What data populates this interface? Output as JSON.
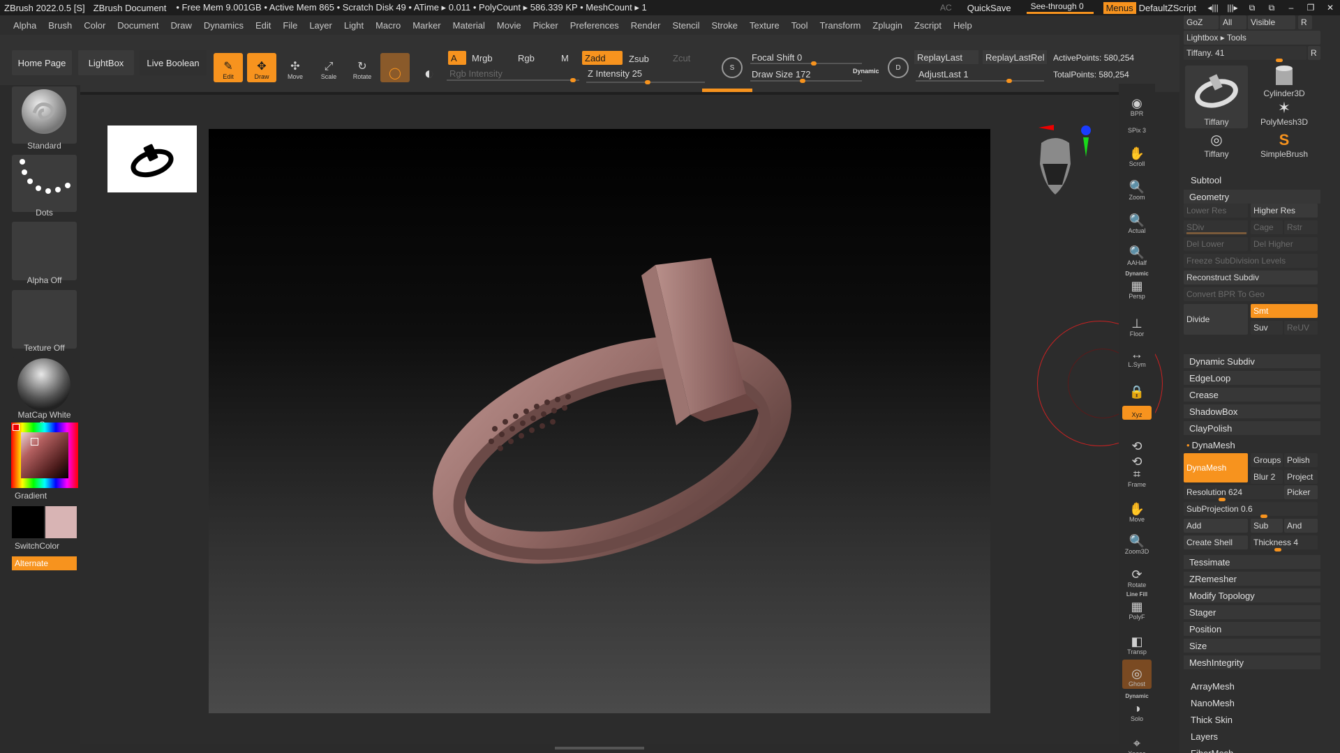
{
  "titlebar": {
    "app": "ZBrush 2022.0.5 [S]",
    "document": "ZBrush Document",
    "stats": "• Free Mem 9.001GB • Active Mem 865 • Scratch Disk 49 •   ATime ▸ 0.011 • PolyCount ▸ 586.339 KP  • MeshCount ▸ 1",
    "ac": "AC",
    "quicksave": "QuickSave",
    "see_through": "See-through  0",
    "menus": "Menus",
    "default_zscript": "DefaultZScript"
  },
  "menubar": [
    "Alpha",
    "Brush",
    "Color",
    "Document",
    "Draw",
    "Dynamics",
    "Edit",
    "File",
    "Layer",
    "Light",
    "Macro",
    "Marker",
    "Material",
    "Movie",
    "Picker",
    "Preferences",
    "Render",
    "Stencil",
    "Stroke",
    "Texture",
    "Tool",
    "Transform",
    "Zplugin",
    "Zscript",
    "Help"
  ],
  "shelf": {
    "home_page": "Home Page",
    "lightbox": "LightBox",
    "live_boolean": "Live Boolean",
    "tools": [
      {
        "label": "Edit",
        "active": true
      },
      {
        "label": "Draw",
        "active": true
      },
      {
        "label": "Move",
        "active": false
      },
      {
        "label": "Scale",
        "active": false
      },
      {
        "label": "Rotate",
        "active": false
      }
    ],
    "a": "A",
    "mrgb": "Mrgb",
    "rgb": "Rgb",
    "m": "M",
    "zadd": "Zadd",
    "zsub": "Zsub",
    "zcut": "Zcut",
    "rgb_intensity": "Rgb Intensity",
    "z_intensity": "Z Intensity 25",
    "focal_shift": "Focal Shift 0",
    "draw_size": "Draw Size 172",
    "dynamic": "Dynamic",
    "replay_last": "ReplayLast",
    "replay_last_rel": "ReplayLastRel",
    "adjust_last": "AdjustLast 1",
    "active_points": "ActivePoints: 580,254",
    "total_points": "TotalPoints: 580,254",
    "s_label": "S",
    "d_label": "D"
  },
  "left": {
    "brush": "Standard",
    "stroke": "Dots",
    "alpha": "Alpha Off",
    "texture": "Texture Off",
    "material": "MatCap White Ca",
    "gradient": "Gradient",
    "switch_color": "SwitchColor",
    "alternate": "Alternate",
    "colors": {
      "main": "#000000",
      "secondary": "#d8b4b4",
      "accent": "#f7931e"
    }
  },
  "rshelf": [
    "BPR",
    "SPix 3",
    "Scroll",
    "Zoom",
    "Actual",
    "AAHalf",
    "Persp",
    "Floor",
    "L.Sym",
    "",
    "Xyz",
    "",
    "",
    "Frame",
    "Move",
    "Zoom3D",
    "Rotate",
    "PolyF",
    "Transp",
    "Ghost",
    "Solo",
    "Xpose"
  ],
  "rshelf_sub": {
    "persp_dynamic": "Dynamic",
    "polyf_linefill": "Line Fill",
    "solo_dynamic": "Dynamic"
  },
  "tray": {
    "goz": "GoZ",
    "all": "All",
    "visible": "Visible",
    "r": "R",
    "lightbox_tools": "Lightbox ▸ Tools",
    "tiffany_slider": "Tiffany. 41",
    "tools": [
      "Tiffany",
      "Cylinder3D",
      "PolyMesh3D",
      "Tiffany",
      "SimpleBrush"
    ],
    "subtool": "Subtool",
    "geometry": "Geometry",
    "lower_res": "Lower Res",
    "higher_res": "Higher Res",
    "sdiv": "SDiv",
    "cage": "Cage",
    "rstr": "Rstr",
    "del_lower": "Del Lower",
    "del_higher": "Del Higher",
    "freeze": "Freeze SubDivision Levels",
    "reconstruct": "Reconstruct Subdiv",
    "convert_bpr": "Convert BPR To Geo",
    "divide": "Divide",
    "smt": "Smt",
    "suv": "Suv",
    "reuv": "ReUV",
    "geo_items": [
      "Dynamic Subdiv",
      "EdgeLoop",
      "Crease",
      "ShadowBox",
      "ClayPolish"
    ],
    "dynamesh_header": "DynaMesh",
    "dynamesh_btn": "DynaMesh",
    "groups": "Groups",
    "polish": "Polish",
    "blur": "Blur 2",
    "project": "Project",
    "resolution": "Resolution 624",
    "picker": "Picker",
    "subprojection": "SubProjection 0.6",
    "add": "Add",
    "sub": "Sub",
    "and": "And",
    "create_shell": "Create Shell",
    "thickness": "Thickness 4",
    "geo_items2": [
      "Tessimate",
      "ZRemesher",
      "Modify Topology",
      "Stager",
      "Position",
      "Size",
      "MeshIntegrity"
    ],
    "tool_sections": [
      "ArrayMesh",
      "NanoMesh",
      "Thick Skin",
      "Layers",
      "FiberMesh"
    ]
  }
}
